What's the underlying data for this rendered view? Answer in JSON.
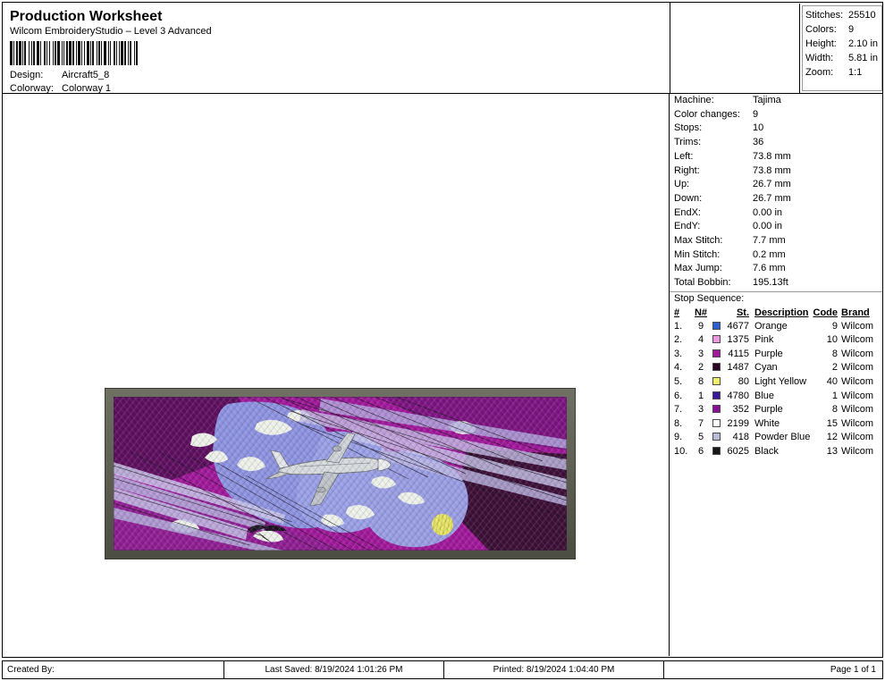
{
  "header": {
    "title": "Production Worksheet",
    "subtitle": "Wilcom EmbroideryStudio – Level 3 Advanced",
    "barcode_name": "barcode",
    "design_label": "Design:",
    "design_value": "Aircraft5_8",
    "colorway_label": "Colorway:",
    "colorway_value": "Colorway 1"
  },
  "summary": [
    {
      "label": "Stitches:",
      "value": "25510"
    },
    {
      "label": "Colors:",
      "value": "9"
    },
    {
      "label": "Height:",
      "value": "2.10 in"
    },
    {
      "label": "Width:",
      "value": "5.81 in"
    },
    {
      "label": "Zoom:",
      "value": "1:1"
    }
  ],
  "info": [
    {
      "label": "Machine:",
      "value": "Tajima"
    },
    {
      "label": "Color changes:",
      "value": "9"
    },
    {
      "label": "Stops:",
      "value": "10"
    },
    {
      "label": "Trims:",
      "value": "36"
    },
    {
      "label": "Left:",
      "value": "73.8 mm"
    },
    {
      "label": "Right:",
      "value": "73.8 mm"
    },
    {
      "label": "Up:",
      "value": "26.7 mm"
    },
    {
      "label": "Down:",
      "value": "26.7 mm"
    },
    {
      "label": "EndX:",
      "value": "0.00 in"
    },
    {
      "label": "EndY:",
      "value": "0.00 in"
    },
    {
      "label": "Max Stitch:",
      "value": "7.7 mm"
    },
    {
      "label": "Min Stitch:",
      "value": "0.2 mm"
    },
    {
      "label": "Max Jump:",
      "value": "7.6 mm"
    },
    {
      "label": "Total Bobbin:",
      "value": "195.13ft"
    }
  ],
  "stop_sequence": {
    "label": "Stop Sequence:",
    "columns": [
      "#",
      "N#",
      "",
      "St.",
      "Description",
      "Code",
      "Brand"
    ],
    "rows": [
      {
        "num": "1.",
        "n": "9",
        "swatch": "#2e5fd0",
        "st": "4677",
        "desc": "Orange",
        "code": "9",
        "brand": "Wilcom"
      },
      {
        "num": "2.",
        "n": "4",
        "swatch": "#ed96e0",
        "st": "1375",
        "desc": "Pink",
        "code": "10",
        "brand": "Wilcom"
      },
      {
        "num": "3.",
        "n": "3",
        "swatch": "#a2199c",
        "st": "4115",
        "desc": "Purple",
        "code": "8",
        "brand": "Wilcom"
      },
      {
        "num": "4.",
        "n": "2",
        "swatch": "#2b0526",
        "st": "1487",
        "desc": "Cyan",
        "code": "2",
        "brand": "Wilcom"
      },
      {
        "num": "5.",
        "n": "8",
        "swatch": "#f2f06a",
        "st": "80",
        "desc": "Light Yellow",
        "code": "40",
        "brand": "Wilcom"
      },
      {
        "num": "6.",
        "n": "1",
        "swatch": "#3a189c",
        "st": "4780",
        "desc": "Blue",
        "code": "1",
        "brand": "Wilcom"
      },
      {
        "num": "7.",
        "n": "3",
        "swatch": "#8c0f96",
        "st": "352",
        "desc": "Purple",
        "code": "8",
        "brand": "Wilcom"
      },
      {
        "num": "8.",
        "n": "7",
        "swatch": "#ffffff",
        "st": "2199",
        "desc": "White",
        "code": "15",
        "brand": "Wilcom"
      },
      {
        "num": "9.",
        "n": "5",
        "swatch": "#b9bcd8",
        "st": "418",
        "desc": "Powder Blue",
        "code": "12",
        "brand": "Wilcom"
      },
      {
        "num": "10.",
        "n": "6",
        "swatch": "#171717",
        "st": "6025",
        "desc": "Black",
        "code": "13",
        "brand": "Wilcom"
      }
    ]
  },
  "design_preview": {
    "name": "aircraft-embroidery-preview",
    "alt": "Embroidered aircraft over stylized cloud map in magenta, purple and blue"
  },
  "footer": {
    "created_by": "Created By:",
    "last_saved": "Last Saved: 8/19/2024 1:01:26 PM",
    "printed": "Printed: 8/19/2024 1:04:40 PM",
    "page": "Page 1 of 1"
  }
}
